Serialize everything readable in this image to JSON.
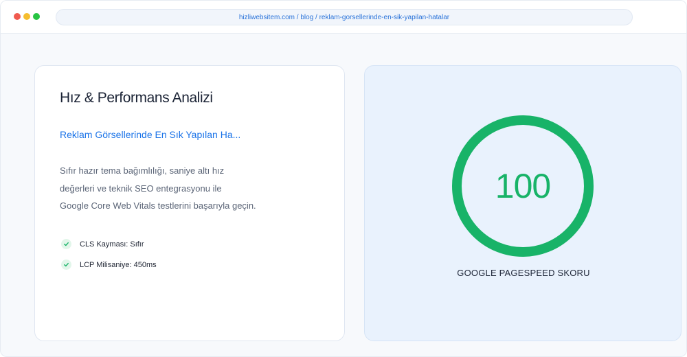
{
  "browser": {
    "url": "hizliwebsitem.com / blog / reklam-gorsellerinde-en-sik-yapilan-hatalar",
    "controls": [
      "close",
      "minimize",
      "maximize"
    ]
  },
  "analysis_card": {
    "title": "Hız & Performans Analizi",
    "article_link": "Reklam Görsellerinde En Sık Yapılan Ha...",
    "description_lines": [
      "Sıfır hazır tema bağımlılığı, saniye altı hız",
      "değerleri ve teknik SEO entegrasyonu ile",
      "Google Core Web Vitals testlerini başarıyla geçin."
    ],
    "metrics": [
      {
        "label": "CLS Kayması: Sıfır",
        "icon": "check-icon"
      },
      {
        "label": "LCP Milisaniye: 450ms",
        "icon": "check-icon"
      }
    ]
  },
  "score_card": {
    "score": "100",
    "score_fraction": 1.0,
    "label": "GOOGLE PAGESPEED SKORU",
    "ring_color": "#18b368"
  },
  "colors": {
    "accent_link": "#1a73e8",
    "success": "#18b368",
    "panel_bg": "#e9f2fd"
  }
}
